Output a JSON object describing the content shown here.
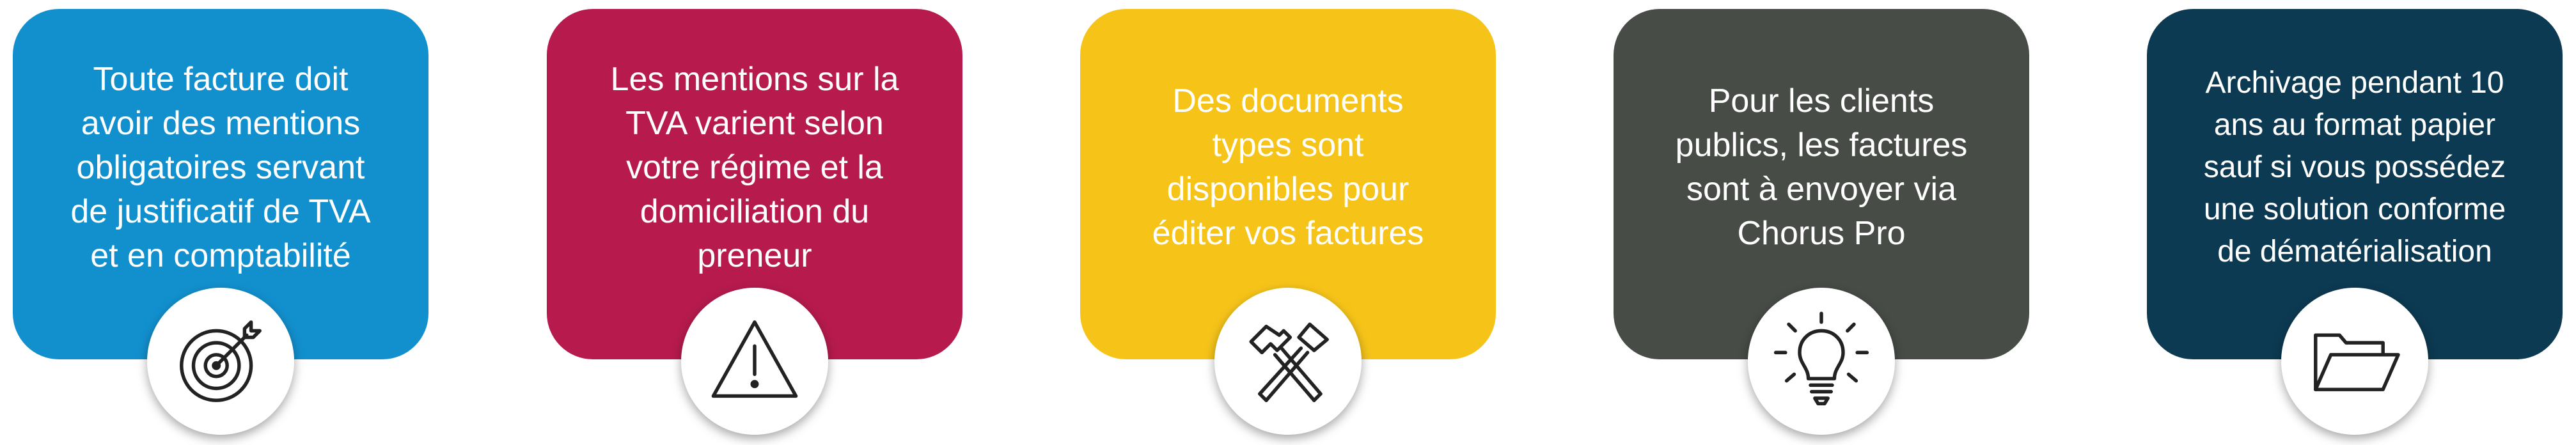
{
  "cards": [
    {
      "text": "Toute facture doit\navoir des mentions\nobligatoires servant\nde justificatif de TVA\net en comptabilité",
      "color": "#1290CE",
      "icon": "target-icon"
    },
    {
      "text": "Les mentions sur la\nTVA varient selon\nvotre régime et la\ndomiciliation du\npreneur",
      "color": "#B71B4E",
      "icon": "warning-icon"
    },
    {
      "text": "Des documents\ntypes sont\ndisponibles pour\néditer vos factures",
      "color": "#F6C419",
      "icon": "hammers-icon"
    },
    {
      "text": "Pour les clients\npublics, les factures\nsont à envoyer via\nChorus Pro",
      "color": "#474C47",
      "icon": "lightbulb-icon"
    },
    {
      "text": "Archivage pendant 10\nans au format papier\nsauf si vous possédez\nune solution conforme\nde dématérialisation",
      "color": "#0C3A52",
      "icon": "folder-icon"
    }
  ]
}
